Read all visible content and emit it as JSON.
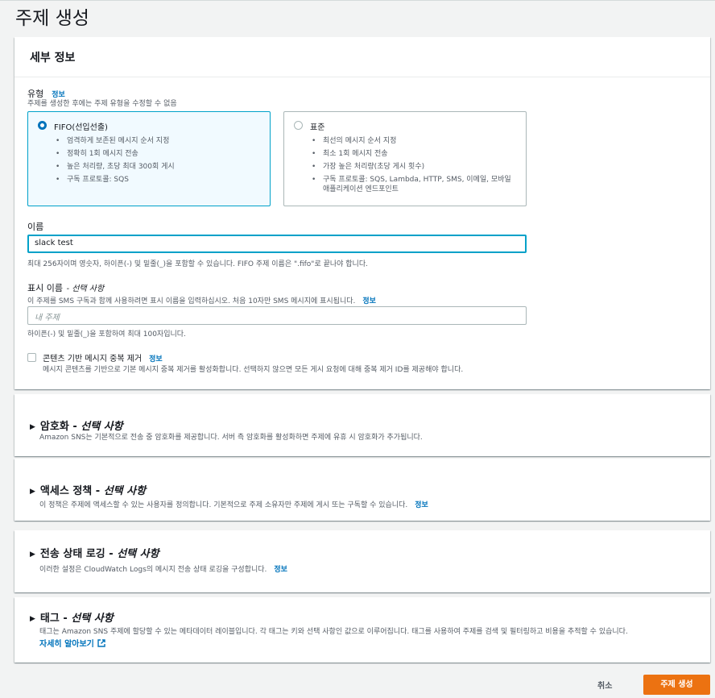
{
  "page": {
    "title": "주제 생성"
  },
  "details": {
    "header": "세부 정보",
    "type": {
      "label": "유형",
      "info": "정보",
      "description": "주제를 생성한 후에는 주제 유형을 수정할 수 없음",
      "options": [
        {
          "title": "FIFO(선입선출)",
          "selected": true,
          "bullets": [
            "엄격하게 보존된 메시지 순서 지정",
            "정확히 1회 메시지 전송",
            "높은 처리량, 초당 최대 300회 게시",
            "구독 프로토콜: SQS"
          ]
        },
        {
          "title": "표준",
          "selected": false,
          "bullets": [
            "최선의 메시지 순서 지정",
            "최소 1회 메시지 전송",
            "가장 높은 처리량(초당 게시 횟수)",
            "구독 프로토콜: SQS, Lambda, HTTP, SMS, 이메일, 모바일 애플리케이션 엔드포인트"
          ]
        }
      ]
    },
    "name": {
      "label": "이름",
      "value": "slack test",
      "hint": "최대 256자이며 영숫자, 하이픈(-) 및 밑줄(_)을 포함할 수 있습니다. FIFO 주제 이름은 \".fifo\"로 끝나야 합니다."
    },
    "display_name": {
      "label": "표시 이름",
      "optional": "- 선택 사항",
      "description": "이 주제를 SMS 구독과 함께 사용하려면 표시 이름을 입력하십시오. 처음 10자만 SMS 메시지에 표시됩니다.",
      "info": "정보",
      "placeholder": "내 주제",
      "hint": "하이픈(-) 및 밑줄(_)을 포함하여 최대 100자입니다."
    },
    "dedup": {
      "label": "콘텐츠 기반 메시지 중복 제거",
      "info": "정보",
      "checked": false,
      "description": "메시지 콘텐츠를 기반으로 기본 메시지 중복 제거를 활성화합니다. 선택하지 않으면 모든 게시 요청에 대해 중복 제거 ID를 제공해야 합니다."
    }
  },
  "sections": [
    {
      "title": "암호화",
      "optional": "선택 사항",
      "description": "Amazon SNS는 기본적으로 전송 중 암호화를 제공합니다. 서버 측 암호화를 활성화하면 주제에 유휴 시 암호화가 추가됩니다.",
      "info": ""
    },
    {
      "title": "액세스 정책",
      "optional": "선택 사항",
      "description": "이 정책은 주제에 액세스할 수 있는 사용자를 정의합니다. 기본적으로 주제 소유자만 주제에 게시 또는 구독할 수 있습니다.",
      "info": "정보"
    },
    {
      "title": "전송 상태 로깅",
      "optional": "선택 사항",
      "description": "이러한 설정은 CloudWatch Logs의 메시지 전송 상태 로깅을 구성합니다.",
      "info": "정보"
    },
    {
      "title": "태그",
      "optional": "선택 사항",
      "description": "태그는 Amazon SNS 주제에 할당할 수 있는 메타데이터 레이블입니다. 각 태그는 키와 선택 사항인 값으로 이루어집니다. 태그를 사용하여 주제를 검색 및 필터링하고 비용을 추적할 수 있습니다.",
      "info": "",
      "link": "자세히 알아보기"
    }
  ],
  "footer": {
    "cancel": "취소",
    "create": "주제 생성"
  },
  "colors": {
    "primary": "#ec7211",
    "link": "#0073bb",
    "focus": "#00a1c9"
  },
  "icons": {
    "expand": "caret-right-icon",
    "external": "external-link-icon",
    "radio": "radio-icon"
  }
}
